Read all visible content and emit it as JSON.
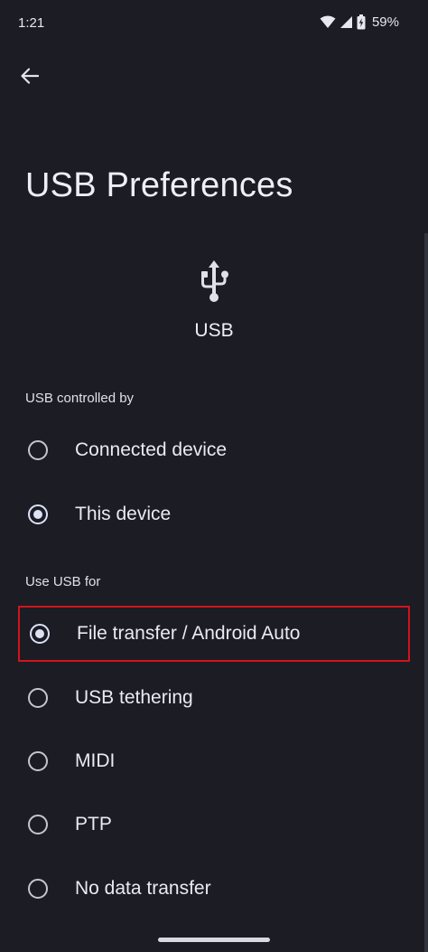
{
  "status_bar": {
    "time": "1:21",
    "battery": "59%"
  },
  "page": {
    "title": "USB Preferences"
  },
  "usb": {
    "label": "USB"
  },
  "controlled_by": {
    "header": "USB controlled by",
    "options": [
      {
        "label": "Connected device",
        "selected": false
      },
      {
        "label": "This device",
        "selected": true
      }
    ]
  },
  "use_usb_for": {
    "header": "Use USB for",
    "options": [
      {
        "label": "File transfer / Android Auto",
        "selected": true,
        "highlighted": true
      },
      {
        "label": "USB tethering",
        "selected": false
      },
      {
        "label": "MIDI",
        "selected": false
      },
      {
        "label": "PTP",
        "selected": false
      },
      {
        "label": "No data transfer",
        "selected": false
      }
    ]
  }
}
